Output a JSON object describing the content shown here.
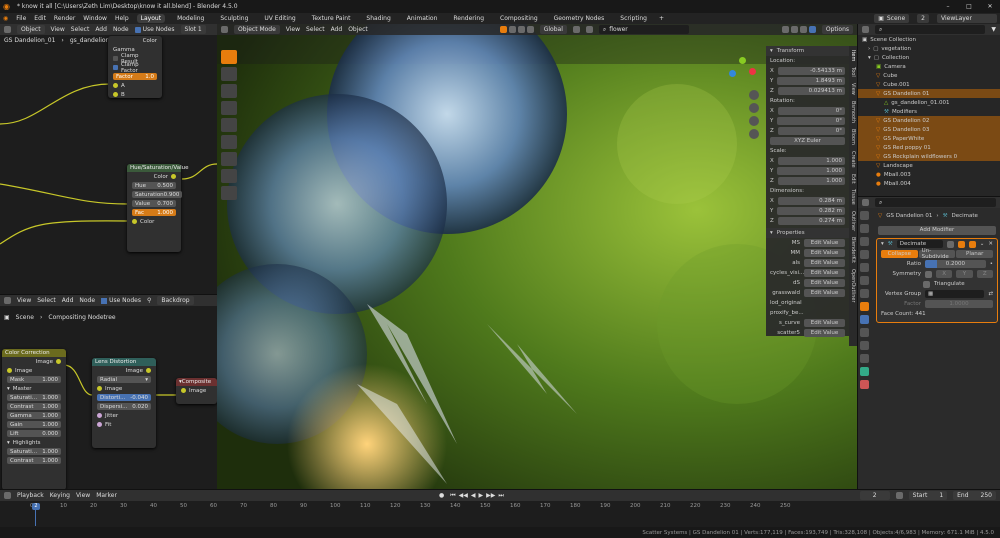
{
  "window": {
    "title": "* know it all [C:\\Users\\Zeth Lim\\Desktop\\know it all.blend] - Blender 4.5.0"
  },
  "menu": {
    "items": [
      "File",
      "Edit",
      "Render",
      "Window",
      "Help"
    ]
  },
  "workspaces": [
    "Layout",
    "Modeling",
    "Sculpting",
    "UV Editing",
    "Texture Paint",
    "Shading",
    "Animation",
    "Rendering",
    "Compositing",
    "Geometry Nodes",
    "Scripting"
  ],
  "scene": {
    "label": "Scene",
    "count": "2",
    "viewlayer": "ViewLayer"
  },
  "shader_editor": {
    "header": [
      "Object",
      "View",
      "Select",
      "Add",
      "Node",
      "Use Nodes"
    ],
    "slot": "Slot 1",
    "breadcrumb": [
      "GS Dandelion_01",
      "gs_dandelion_01_leaves..."
    ]
  },
  "math_node": {
    "rows": [
      "Color",
      "Gamma",
      "Clamp Result",
      "Clamp Factor"
    ],
    "factor_label": "Factor",
    "factor_value": "1.0",
    "a": "A",
    "b": "B",
    "result": "Color"
  },
  "hsv_node": {
    "title": "Hue/Saturation/Value",
    "out": "Color",
    "hue": "0.500",
    "sat": "0.900",
    "val": "0.700",
    "fac": "1.000",
    "in": "Color",
    "labels": [
      "Hue",
      "Saturation",
      "Value",
      "Fac"
    ]
  },
  "comp_editor": {
    "header": [
      "View",
      "Select",
      "Add",
      "Node",
      "Use Nodes"
    ],
    "backdrop": "Backdrop",
    "breadcrumb": [
      "Scene",
      "Compositing Nodetree"
    ]
  },
  "color_correction": {
    "title": "Color Correction",
    "out": "Image",
    "in": "Image",
    "mask": "Mask",
    "mask_val": "1.000",
    "master": "Master",
    "rows": [
      [
        "Saturati...",
        "1.000"
      ],
      [
        "Contrast",
        "1.000"
      ],
      [
        "Gamma",
        "1.000"
      ],
      [
        "Gain",
        "1.000"
      ],
      [
        "Lift",
        "0.000"
      ]
    ],
    "highlights": "Highlights",
    "hrows": [
      [
        "Saturati...",
        "1.000"
      ],
      [
        "Contrast",
        "1.000"
      ]
    ]
  },
  "lens_distortion": {
    "title": "Lens Distortion",
    "out": "Image",
    "type": "Radial",
    "in": "Image",
    "distort_label": "Distorti...",
    "distort": "-0.040",
    "disp_label": "Dispersi...",
    "disp": "0.020",
    "jitter": "Jitter",
    "fit": "Fit"
  },
  "composite": {
    "title": "Composite",
    "in": "Image"
  },
  "viewport": {
    "mode": "Object Mode",
    "header": [
      "View",
      "Select",
      "Add",
      "Object"
    ],
    "orientation": "Global",
    "search": "flower",
    "options": "Options"
  },
  "transform_panel": {
    "title": "Transform",
    "location_label": "Location:",
    "location": [
      "-0.54133 m",
      "1.8493 m",
      "0.029413 m"
    ],
    "rotation_label": "Rotation:",
    "rotation": [
      "0°",
      "0°",
      "0°"
    ],
    "rot_mode": "XYZ Euler",
    "scale_label": "Scale:",
    "scale": [
      "1.000",
      "1.000",
      "1.000"
    ],
    "dims_label": "Dimensions:",
    "dims": [
      "0.284 m",
      "0.282 m",
      "0.274 m"
    ],
    "axes": [
      "X",
      "Y",
      "Z"
    ]
  },
  "properties_panel": {
    "title": "Properties",
    "rows": [
      "MS",
      "MM",
      "als",
      "cycles_visi...",
      "dS",
      "grasswald",
      "lod_original",
      "proxify_be...",
      "s_curve",
      "scatter5"
    ],
    "edit": "Edit Value"
  },
  "side_tabs": [
    "Item",
    "Tool",
    "View",
    "Bsmooth",
    "Bloom",
    "Create",
    "Edit",
    "Tissue",
    "Outliner",
    "BlenderKit",
    "OpenOutliner"
  ],
  "outliner": {
    "root": "Scene Collection",
    "items": [
      {
        "name": "vegetation",
        "depth": 1,
        "sel": false
      },
      {
        "name": "Collection",
        "depth": 1,
        "sel": false
      },
      {
        "name": "Camera",
        "depth": 2,
        "sel": false
      },
      {
        "name": "Cube",
        "depth": 2,
        "sel": false
      },
      {
        "name": "Cube.001",
        "depth": 2,
        "sel": false
      },
      {
        "name": "GS Dandelion 01",
        "depth": 2,
        "sel": true
      },
      {
        "name": "gs_dandelion_01.001",
        "depth": 3,
        "sel": false
      },
      {
        "name": "Modifiers",
        "depth": 3,
        "sel": false
      },
      {
        "name": "GS Dandelion 02",
        "depth": 2,
        "sel": true
      },
      {
        "name": "GS Dandelion 03",
        "depth": 2,
        "sel": true
      },
      {
        "name": "GS PaperWhite",
        "depth": 2,
        "sel": true
      },
      {
        "name": "GS Red poppy 01",
        "depth": 2,
        "sel": true
      },
      {
        "name": "GS Rockplain wildflowers 0",
        "depth": 2,
        "sel": true
      },
      {
        "name": "Landscape",
        "depth": 2,
        "sel": false
      },
      {
        "name": "Mball.003",
        "depth": 2,
        "sel": false
      },
      {
        "name": "Mball.004",
        "depth": 2,
        "sel": false
      }
    ]
  },
  "modifier": {
    "object": "GS Dandelion 01",
    "type": "Decimate",
    "add": "Add Modifier",
    "name": "Decimate",
    "tabs": [
      "Collapse",
      "Un-Subdivide",
      "Planar"
    ],
    "ratio_label": "Ratio",
    "ratio": "0.2000",
    "sym_label": "Symmetry",
    "sym": [
      "X",
      "Y",
      "Z"
    ],
    "tri": "Triangulate",
    "vg_label": "Vertex Group",
    "factor_label": "Factor",
    "factor": "1.0000",
    "face_count": "Face Count: 441"
  },
  "timeline": {
    "header": [
      "Playback",
      "Keying",
      "View",
      "Marker"
    ],
    "current": "2",
    "start_label": "Start",
    "start": "1",
    "end_label": "End",
    "end": "250",
    "ticks": [
      "0",
      "10",
      "20",
      "30",
      "40",
      "50",
      "60",
      "70",
      "80",
      "90",
      "100",
      "110",
      "120",
      "130",
      "140",
      "150",
      "160",
      "170",
      "180",
      "190",
      "200",
      "210",
      "220",
      "230",
      "240",
      "250"
    ],
    "playhead": "2"
  },
  "status": {
    "text": "Scatter Systems | GS Dandelion 01 | Verts:177,119 | Faces:193,749 | Tris:328,108 | Objects:4/6,983 | Memory: 671.1 MiB | 4.5.0"
  }
}
